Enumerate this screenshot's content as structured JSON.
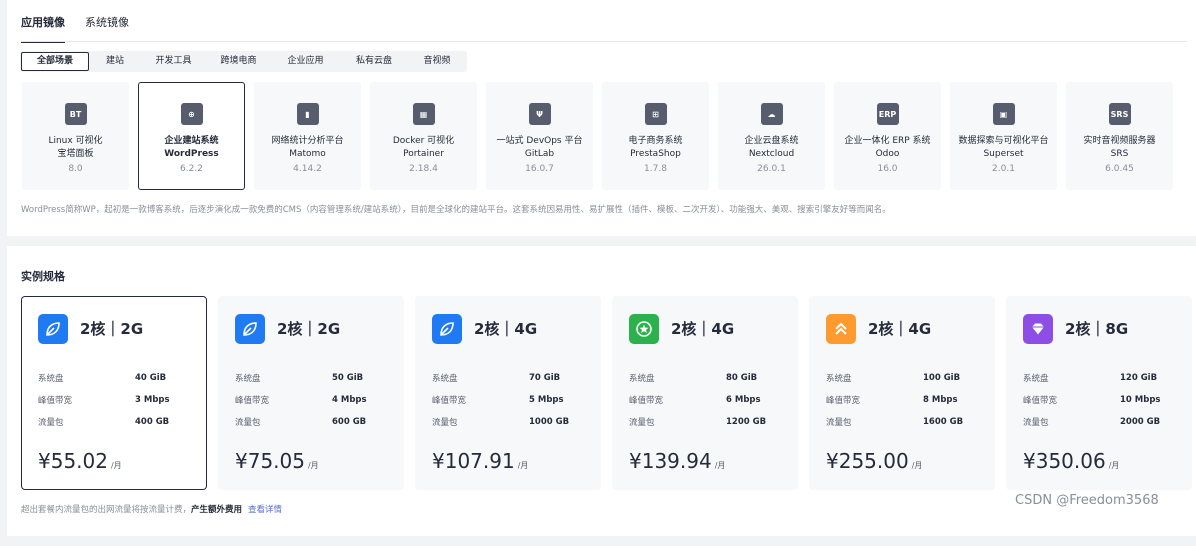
{
  "tabs": [
    {
      "label": "应用镜像",
      "active": true
    },
    {
      "label": "系统镜像",
      "active": false
    }
  ],
  "scenes": [
    {
      "label": "全部场景",
      "active": true
    },
    {
      "label": "建站"
    },
    {
      "label": "开发工具"
    },
    {
      "label": "跨境电商"
    },
    {
      "label": "企业应用"
    },
    {
      "label": "私有云盘"
    },
    {
      "label": "音视频"
    }
  ],
  "apps": [
    {
      "icon": "bt-panel-icon",
      "glyph": "BT",
      "line1": "Linux 可视化",
      "line2": "宝塔面板",
      "version": "8.0"
    },
    {
      "icon": "wordpress-icon",
      "glyph": "⊕",
      "line1": "企业建站系统",
      "line2": "WordPress",
      "version": "6.2.2",
      "active": true
    },
    {
      "icon": "matomo-icon",
      "glyph": "▮",
      "line1": "网络统计分析平台",
      "line2": "Matomo",
      "version": "4.14.2"
    },
    {
      "icon": "portainer-icon",
      "glyph": "▦",
      "line1": "Docker 可视化",
      "line2": "Portainer",
      "version": "2.18.4"
    },
    {
      "icon": "gitlab-icon",
      "glyph": "Ψ",
      "line1": "一站式 DevOps 平台",
      "line2": "GitLab",
      "version": "16.0.7"
    },
    {
      "icon": "prestashop-icon",
      "glyph": "⊞",
      "line1": "电子商务系统",
      "line2": "PrestaShop",
      "version": "1.7.8"
    },
    {
      "icon": "nextcloud-icon",
      "glyph": "☁",
      "line1": "企业云盘系统",
      "line2": "Nextcloud",
      "version": "26.0.1"
    },
    {
      "icon": "odoo-icon",
      "glyph": "ERP",
      "line1": "企业一体化 ERP 系统",
      "line2": "Odoo",
      "version": "16.0"
    },
    {
      "icon": "superset-icon",
      "glyph": "▣",
      "line1": "数据探索与可视化平台",
      "line2": "Superset",
      "version": "2.0.1"
    },
    {
      "icon": "srs-icon",
      "glyph": "SRS",
      "line1": "实时音视频服务器",
      "line2": "SRS",
      "version": "6.0.45"
    }
  ],
  "description": "WordPress简称WP，起初是一款博客系统，后逐步演化成一款免费的CMS（内容管理系统/建站系统），目前是全球化的建站平台。这套系统因易用性、易扩展性（插件、模板、二次开发）、功能强大、美观、搜索引擎友好等而闻名。",
  "spec_section_title": "实例规格",
  "spec_labels": {
    "disk": "系统盘",
    "bandwidth": "峰值带宽",
    "traffic": "流量包"
  },
  "price_unit": "/月",
  "specs": [
    {
      "title": "2核｜2G",
      "disk": "40 GiB",
      "bandwidth": "3 Mbps",
      "traffic": "400 GB",
      "price": "¥55.02",
      "icon": "leaf-icon",
      "color": "#1f7af3",
      "active": true
    },
    {
      "title": "2核｜2G",
      "disk": "50 GiB",
      "bandwidth": "4 Mbps",
      "traffic": "600 GB",
      "price": "¥75.05",
      "icon": "leaf-icon",
      "color": "#1f7af3"
    },
    {
      "title": "2核｜4G",
      "disk": "70 GiB",
      "bandwidth": "5 Mbps",
      "traffic": "1000 GB",
      "price": "¥107.91",
      "icon": "leaf-icon",
      "color": "#1f7af3"
    },
    {
      "title": "2核｜4G",
      "disk": "80 GiB",
      "bandwidth": "6 Mbps",
      "traffic": "1200 GB",
      "price": "¥139.94",
      "icon": "star-icon",
      "color": "#2bb24c"
    },
    {
      "title": "2核｜4G",
      "disk": "100 GiB",
      "bandwidth": "8 Mbps",
      "traffic": "1600 GB",
      "price": "¥255.00",
      "icon": "chevrons-up-icon",
      "color": "#ff9a2e"
    },
    {
      "title": "2核｜8G",
      "disk": "120 GiB",
      "bandwidth": "10 Mbps",
      "traffic": "2000 GB",
      "price": "¥350.06",
      "icon": "diamond-icon",
      "color": "#8e4ee6"
    }
  ],
  "notice": {
    "text": "超出套餐内流量包的出网流量将按流量计费，",
    "emphasis": "产生额外费用",
    "link": "查看详情"
  },
  "watermark": "CSDN @Freedom3568"
}
